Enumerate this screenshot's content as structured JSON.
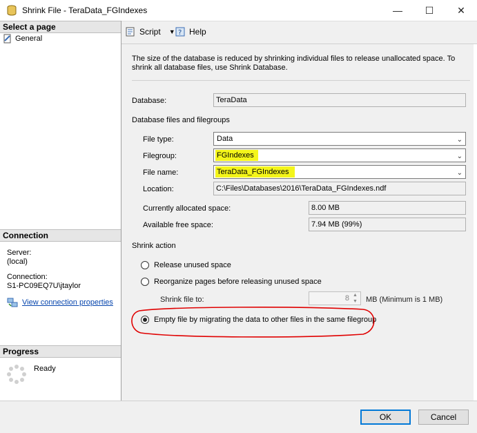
{
  "window": {
    "title": "Shrink File - TeraData_FGIndexes",
    "minimize": "—",
    "maximize": "☐",
    "close": "✕"
  },
  "left": {
    "select_page_header": "Select a page",
    "pages": [
      "General"
    ],
    "connection_header": "Connection",
    "server_label": "Server:",
    "server_value": "(local)",
    "connection_label": "Connection:",
    "connection_value": "S1-PC09EQ7U\\jtaylor",
    "view_connection_link": "View connection properties",
    "progress_header": "Progress",
    "progress_status": "Ready"
  },
  "toolbar": {
    "script_label": "Script",
    "help_label": "Help"
  },
  "main": {
    "description": "The size of the database is reduced by shrinking individual files to release unallocated space. To shrink all database files, use Shrink Database.",
    "database_label": "Database:",
    "database_value": "TeraData",
    "files_section": "Database files and filegroups",
    "file_type_label": "File type:",
    "file_type_value": "Data",
    "filegroup_label": "Filegroup:",
    "filegroup_value": "FGIndexes",
    "file_name_label": "File name:",
    "file_name_value": "TeraData_FGIndexes",
    "location_label": "Location:",
    "location_value": "C:\\Files\\Databases\\2016\\TeraData_FGIndexes.ndf",
    "allocated_label": "Currently allocated space:",
    "allocated_value": "8.00 MB",
    "free_label": "Available free space:",
    "free_value": "7.94 MB (99%)",
    "shrink_action_section": "Shrink action",
    "option_release": "Release unused space",
    "option_reorganize": "Reorganize pages before releasing unused space",
    "shrink_to_label": "Shrink file to:",
    "shrink_to_value": "8",
    "shrink_to_unit": "MB (Minimum is 1 MB)",
    "option_empty": "Empty file by migrating the data to other files in the same filegroup",
    "selected_option": "empty"
  },
  "footer": {
    "ok_label": "OK",
    "cancel_label": "Cancel"
  },
  "colors": {
    "highlight": "#f4f51a",
    "annotation_red": "#e00000",
    "link": "#0645ad"
  }
}
